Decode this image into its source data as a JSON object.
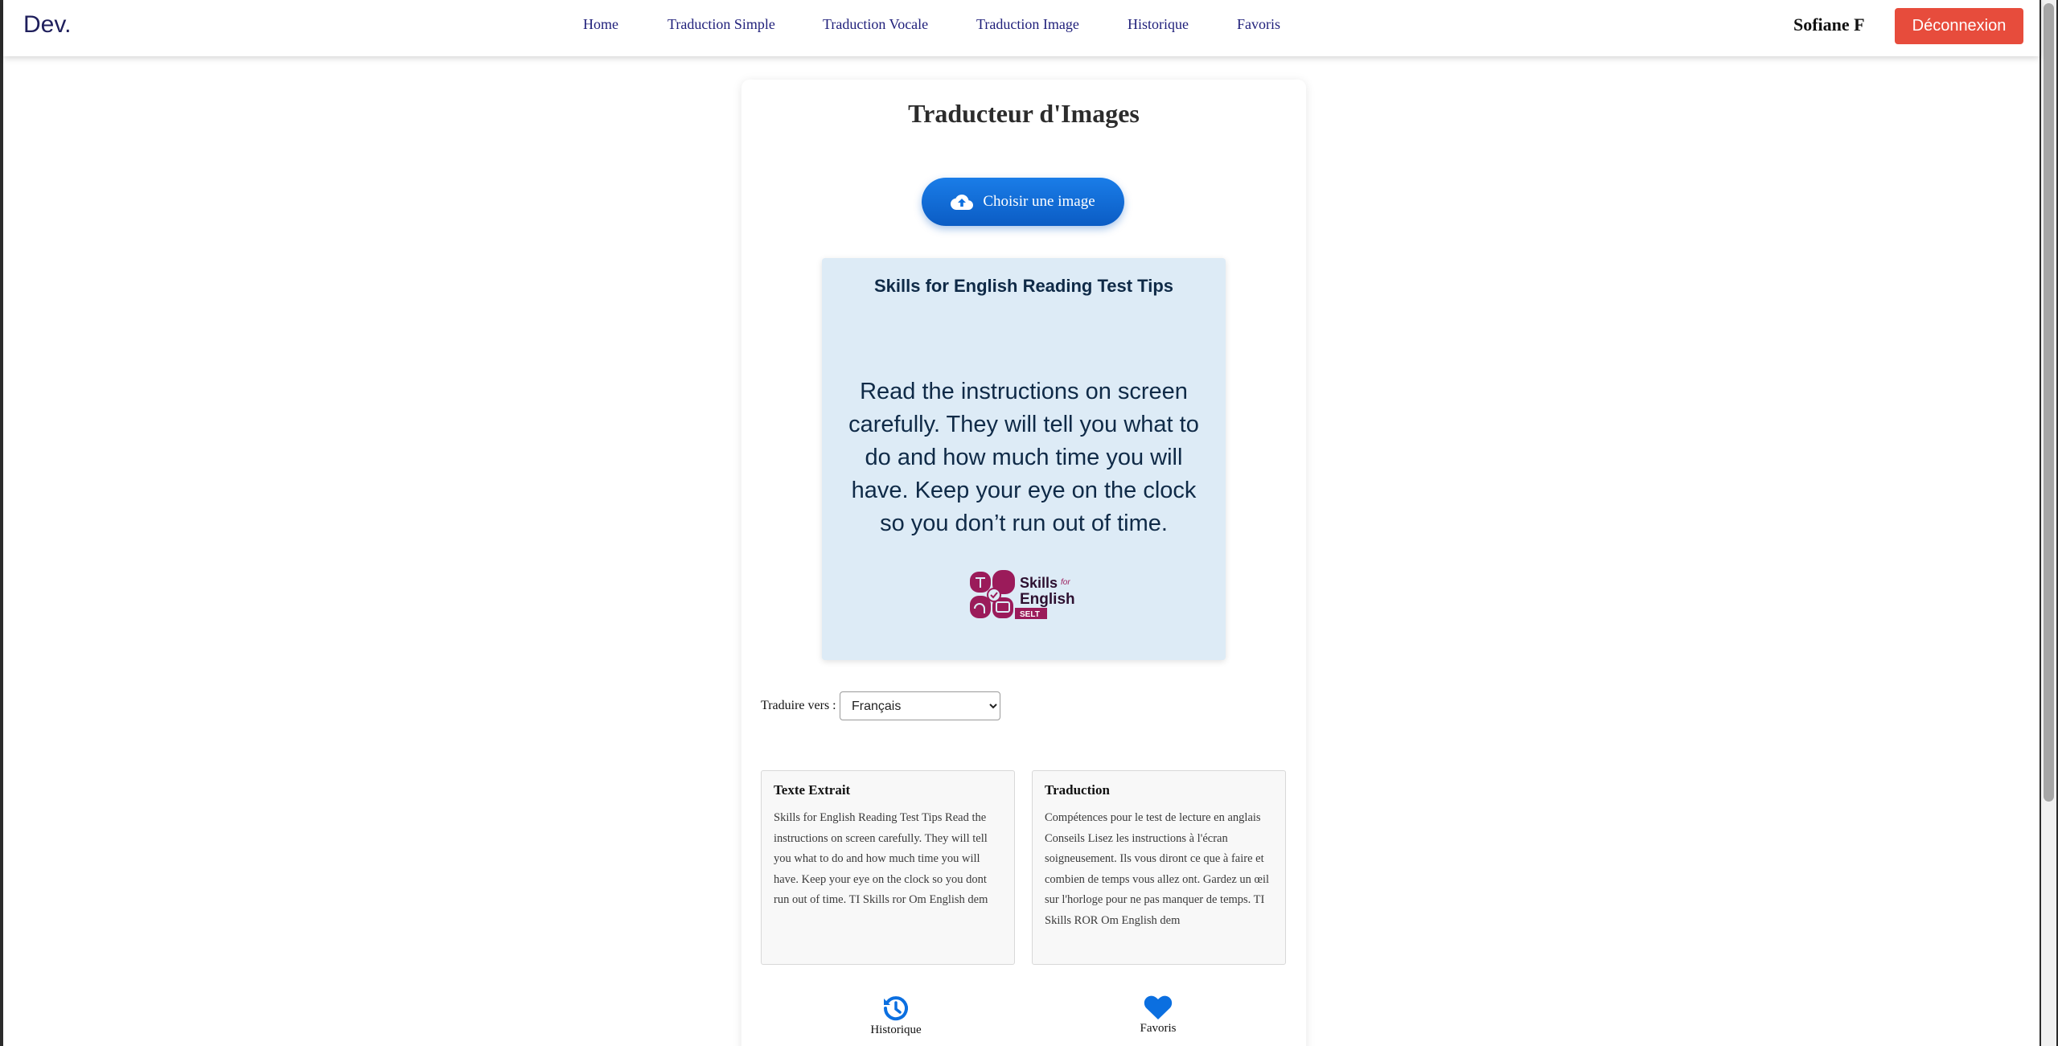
{
  "navbar": {
    "brand": "Dev.",
    "links": [
      {
        "label": "Home"
      },
      {
        "label": "Traduction Simple"
      },
      {
        "label": "Traduction Vocale"
      },
      {
        "label": "Traduction Image"
      },
      {
        "label": "Historique"
      },
      {
        "label": "Favoris"
      }
    ],
    "user_name": "Sofiane F",
    "logout_label": "Déconnexion"
  },
  "main": {
    "title": "Traducteur d'Images",
    "upload_label": "Choisir une image",
    "upload_icon": "cloud-upload-icon",
    "preview": {
      "title": "Skills for English Reading Test Tips",
      "body": "Read the instructions on screen carefully. They will tell you what to do and how much time you will have. Keep your eye on the clock so you don’t run out of time.",
      "logo_text": "Skills for English",
      "logo_badge": "SELT"
    },
    "language": {
      "label": "Traduire vers :",
      "selected": "Français"
    },
    "extracted": {
      "title": "Texte Extrait",
      "text": "Skills for English Reading Test Tips Read the instructions on screen carefully. They will tell you what to do and how much time you will have. Keep your eye on the clock so you dont run out of time. TI Skills ror Om English dem"
    },
    "translation": {
      "title": "Traduction",
      "text": "Compétences pour le test de lecture en anglais Conseils Lisez les instructions à l'écran soigneusement. Ils vous diront ce que à faire et combien de temps vous allez ont. Gardez un œil sur l'horloge pour ne pas manquer de temps. TI Skills ROR Om English dem"
    },
    "actions": {
      "history_label": "Historique",
      "history_icon": "history-icon",
      "favorites_label": "Favoris",
      "favorites_icon": "heart-icon"
    }
  },
  "colors": {
    "accent": "#0b6fe0",
    "logout": "#e74c3c",
    "nav_text": "#1f1f7a",
    "preview_bg": "#ddebf6",
    "logo": "#9b1b5a"
  }
}
